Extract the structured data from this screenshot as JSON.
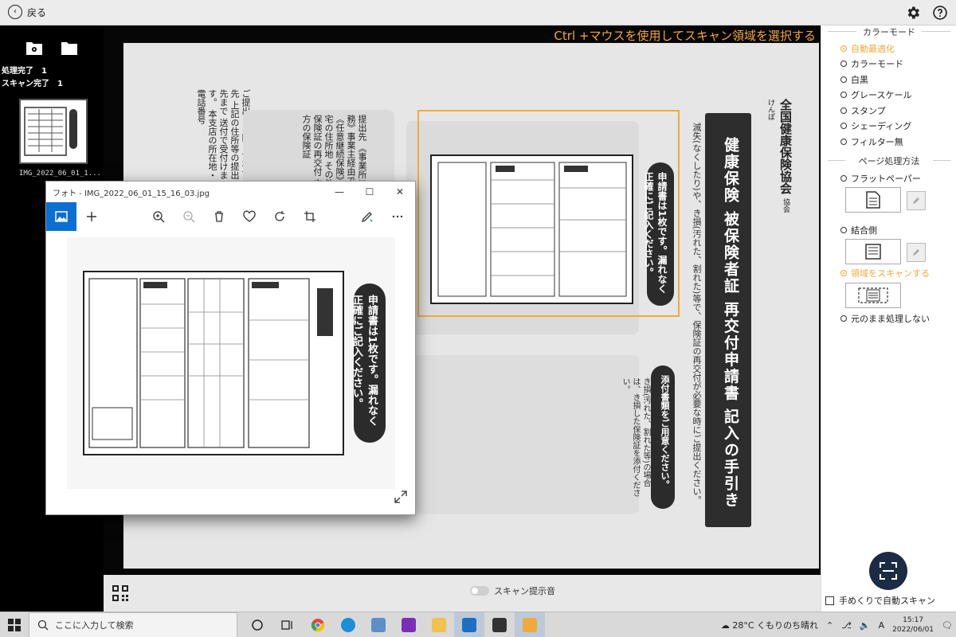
{
  "topbar": {
    "back_label": "戻る"
  },
  "left_panel": {
    "processed_label": "処理完了",
    "processed_count": "1",
    "scanned_label": "スキャン完了",
    "scanned_count": "1",
    "thumbnail_name": "IMG_2022_06_01_1..."
  },
  "canvas": {
    "hint": "Ctrl +マウスを使用してスキャン領域を選択する",
    "doc_logo": "全国健康保険協会",
    "doc_logo_sub": "協会けんぽ",
    "doc_title": "健康保険 被保険者証 再交付申請書 記入の手引き",
    "doc_caption": "滅失(なくしたり)や、き損(汚れた、割れた)等で、保険証の再交付が必要な時にご提出ください。",
    "doc_pill1": "申請書は1枚です。漏れなく正確にご記入ください。",
    "doc_pill2": "添付書類をご用意ください。",
    "doc_note2": "き損(汚れた、割れた等)の場合は、き損した保険証を添付ください。",
    "doc_mid": "提出先 《事業所に勤務》事業主経由で 《任意継続保険》ご自宅の住所地 その他 ◎保険証の再交付 古い方の保険証",
    "doc_left": "ご提出・お問い合わせ先 上記の住所等の提出先まで 送付で受付けます。 本支店の所在地・電話番号"
  },
  "bottom": {
    "scan_sound_label": "スキャン提示音"
  },
  "right_panel": {
    "color_mode_header": "カラーモード",
    "color_options": [
      "自動最適化",
      "カラーモード",
      "白黒",
      "グレースケール",
      "スタンプ",
      "シェーディング",
      "フィルター無"
    ],
    "selected_color": 0,
    "page_header": "ページ処理方法",
    "page_options": [
      "フラットペーパー",
      "結合側",
      "領域をスキャンする",
      "元のまま処理しない"
    ],
    "selected_page": 2,
    "auto_scan_label": "手めくりで自動スキャン"
  },
  "photos": {
    "title": "フォト - IMG_2022_06_01_15_16_03.jpg",
    "pill": "申請書は1枚です。漏れなく正確にご記入ください。"
  },
  "taskbar": {
    "search_placeholder": "ここに入力して検索",
    "weather": "28°C くもりのち晴れ",
    "ime": "A",
    "time": "15:17",
    "date": "2022/06/01"
  },
  "colors": {
    "accent": "#f2a73b",
    "photos_accent": "#0a6fd1",
    "scan_button": "#1b2b44"
  }
}
